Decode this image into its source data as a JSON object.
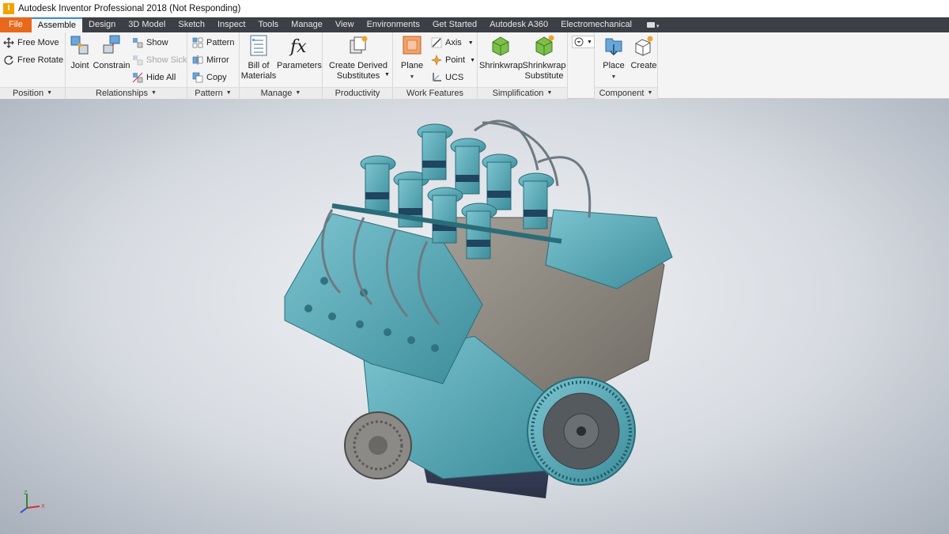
{
  "window": {
    "title": "Autodesk Inventor Professional 2018 (Not Responding)",
    "logo_letter": "I"
  },
  "tabs": [
    {
      "label": "File"
    },
    {
      "label": "Assemble"
    },
    {
      "label": "Design"
    },
    {
      "label": "3D Model"
    },
    {
      "label": "Sketch"
    },
    {
      "label": "Inspect"
    },
    {
      "label": "Tools"
    },
    {
      "label": "Manage"
    },
    {
      "label": "View"
    },
    {
      "label": "Environments"
    },
    {
      "label": "Get Started"
    },
    {
      "label": "Autodesk A360"
    },
    {
      "label": "Electromechanical"
    }
  ],
  "ribbon": {
    "position": {
      "title": "Position",
      "free_move": "Free Move",
      "free_rotate": "Free Rotate"
    },
    "relationships": {
      "title": "Relationships",
      "joint": "Joint",
      "constrain": "Constrain",
      "show": "Show",
      "show_sick": "Show Sick",
      "hide_all": "Hide All"
    },
    "pattern": {
      "title": "Pattern",
      "pattern": "Pattern",
      "mirror": "Mirror",
      "copy": "Copy"
    },
    "manage": {
      "title": "Manage",
      "bom_line1": "Bill of",
      "bom_line2": "Materials",
      "parameters": "Parameters"
    },
    "productivity": {
      "title": "Productivity",
      "cds_line1": "Create Derived",
      "cds_line2": "Substitutes"
    },
    "work_features": {
      "title": "Work Features",
      "plane": "Plane",
      "axis": "Axis",
      "point": "Point",
      "ucs": "UCS"
    },
    "simplification": {
      "title": "Simplification",
      "shrinkwrap": "Shrinkwrap",
      "sws_line1": "Shrinkwrap",
      "sws_line2": "Substitute"
    },
    "component": {
      "title": "Component",
      "place": "Place",
      "create": "Create"
    }
  },
  "colors": {
    "accent": "#e8681c",
    "tabbar": "#3c3f45",
    "part_teal": "#4fa3b1",
    "block_grey": "#8c8880"
  }
}
